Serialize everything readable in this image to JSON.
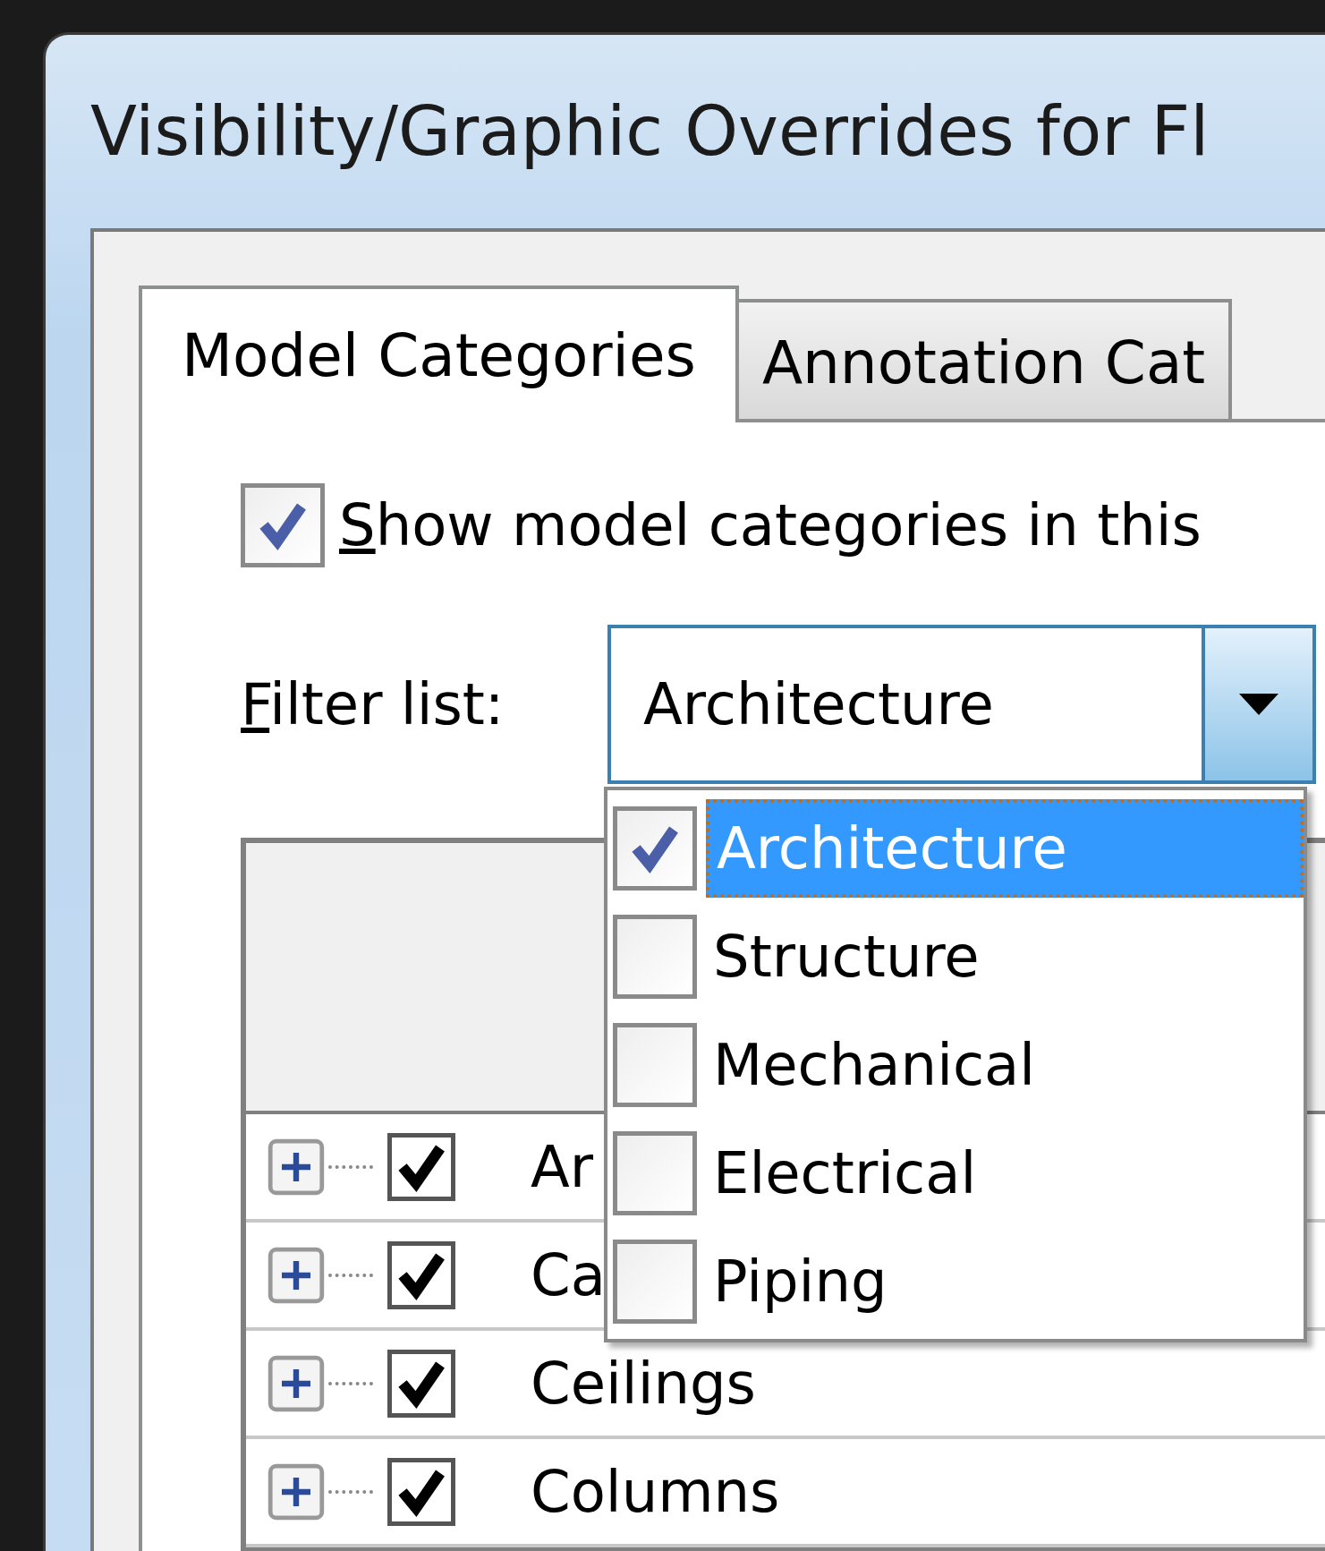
{
  "window": {
    "title": "Visibility/Graphic Overrides for Fl"
  },
  "tabs": [
    {
      "label": "Model Categories",
      "selected": true
    },
    {
      "label": "Annotation Cat",
      "selected": false
    }
  ],
  "show_categories": {
    "label": "Show model categories in this",
    "checked": true
  },
  "filter": {
    "label": "Filter list:",
    "value": "Architecture",
    "expanded": true,
    "options": [
      {
        "label": "Architecture",
        "checked": true,
        "selected": true
      },
      {
        "label": "Structure",
        "checked": false,
        "selected": false
      },
      {
        "label": "Mechanical",
        "checked": false,
        "selected": false
      },
      {
        "label": "Electrical",
        "checked": false,
        "selected": false
      },
      {
        "label": "Piping",
        "checked": false,
        "selected": false
      }
    ]
  },
  "categories": {
    "rows": [
      {
        "name": "Ar",
        "checked": true,
        "expanded": false
      },
      {
        "name": "Ca",
        "checked": true,
        "expanded": false
      },
      {
        "name": "Ceilings",
        "checked": true,
        "expanded": false
      },
      {
        "name": "Columns",
        "checked": true,
        "expanded": false
      }
    ]
  }
}
